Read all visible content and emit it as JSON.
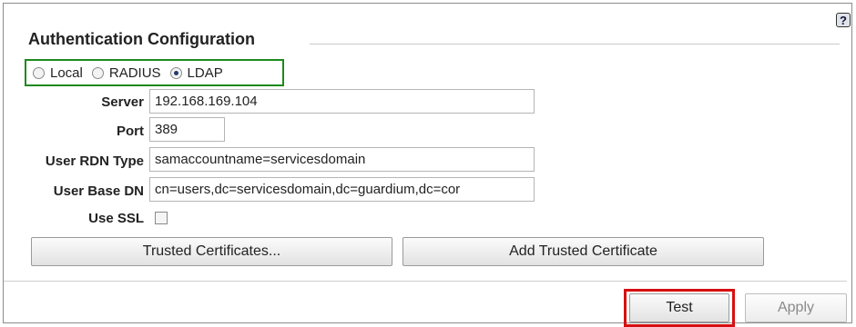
{
  "help": {
    "glyph": "?"
  },
  "section": {
    "title": "Authentication Configuration"
  },
  "auth_methods": {
    "options": [
      "Local",
      "RADIUS",
      "LDAP"
    ],
    "selected": "LDAP"
  },
  "form": {
    "server": {
      "label": "Server",
      "value": "192.168.169.104"
    },
    "port": {
      "label": "Port",
      "value": "389"
    },
    "user_rdn_type": {
      "label": "User RDN Type",
      "value": "samaccountname=servicesdomain"
    },
    "user_base_dn": {
      "label": "User Base DN",
      "value": "cn=users,dc=servicesdomain,dc=guardium,dc=cor"
    },
    "use_ssl": {
      "label": "Use SSL",
      "checked": false
    }
  },
  "buttons": {
    "trusted_certificates": "Trusted Certificates...",
    "add_trusted_certificate": "Add Trusted Certificate",
    "test": "Test",
    "apply": "Apply"
  },
  "colors": {
    "highlight_green": "#1d8a1d",
    "highlight_red": "#d61010"
  }
}
